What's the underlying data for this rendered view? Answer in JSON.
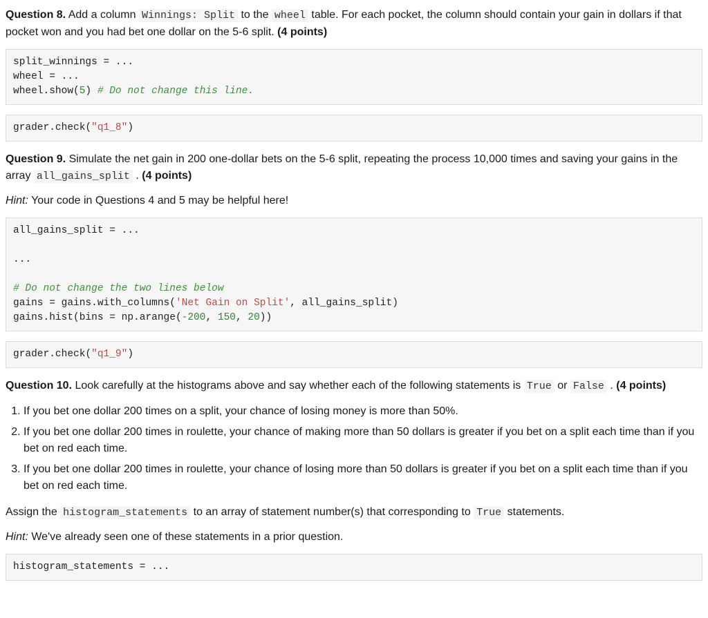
{
  "q8": {
    "label": "Question 8.",
    "text_before_code1": " Add a column ",
    "code1": "Winnings: Split",
    "text_mid1": " to the ",
    "code2": "wheel",
    "text_after": " table. For each pocket, the column should contain your gain in dollars if that pocket won and you had bet one dollar on the 5-6 split. ",
    "points": "(4 points)",
    "cell1_line1_a": "split_winnings ",
    "cell1_line1_b": "=",
    "cell1_line1_c": " ...",
    "cell1_line2_a": "wheel ",
    "cell1_line2_b": "=",
    "cell1_line2_c": " ...",
    "cell1_line3_a": "wheel.show(",
    "cell1_line3_num": "5",
    "cell1_line3_b": ") ",
    "cell1_line3_comment": "# Do not change this line.",
    "cell2_a": "grader.check(",
    "cell2_str": "\"q1_8\"",
    "cell2_b": ")"
  },
  "q9": {
    "label": "Question 9.",
    "text_a": " Simulate the net gain in 200 one-dollar bets on the 5-6 split, repeating the process 10,000 times and saving your gains in the array ",
    "code1": "all_gains_split",
    "text_b": " . ",
    "points": "(4 points)",
    "hint_label": "Hint:",
    "hint_text": " Your code in Questions 4 and 5 may be helpful here!",
    "cell1_l1_a": "all_gains_split ",
    "cell1_l1_b": "=",
    "cell1_l1_c": " ...",
    "cell1_l2": "",
    "cell1_l3": "...",
    "cell1_l4": "",
    "cell1_l5_comment": "# Do not change the two lines below",
    "cell1_l6_a": "gains ",
    "cell1_l6_b": "=",
    "cell1_l6_c": " gains.with_columns(",
    "cell1_l6_str": "'Net Gain on Split'",
    "cell1_l6_d": ", all_gains_split)",
    "cell1_l7_a": "gains.hist(bins ",
    "cell1_l7_b": "=",
    "cell1_l7_c": " np.arange(",
    "cell1_l7_neg": "-",
    "cell1_l7_n1": "200",
    "cell1_l7_d": ", ",
    "cell1_l7_n2": "150",
    "cell1_l7_e": ", ",
    "cell1_l7_n3": "20",
    "cell1_l7_f": "))",
    "cell2_a": "grader.check(",
    "cell2_str": "\"q1_9\"",
    "cell2_b": ")"
  },
  "q10": {
    "label": "Question 10.",
    "text_a": " Look carefully at the histograms above and say whether each of the following statements is ",
    "code_true": "True",
    "text_b": " or ",
    "code_false": "False",
    "text_c": " . ",
    "points": "(4 points)",
    "stmt1": "If you bet one dollar 200 times on a split, your chance of losing money is more than 50%.",
    "stmt2": "If you bet one dollar 200 times in roulette, your chance of making more than 50 dollars is greater if you bet on a split each time than if you bet on red each time.",
    "stmt3": "If you bet one dollar 200 times in roulette, your chance of losing more than 50 dollars is greater if you bet on a split each time than if you bet on red each time.",
    "assign_a": "Assign the ",
    "assign_code": "histogram_statements",
    "assign_b": " to an array of statement number(s) that corresponding to ",
    "assign_true": "True",
    "assign_c": " statements.",
    "hint_label": "Hint:",
    "hint_text": " We've already seen one of these statements in a prior question.",
    "cell_a": "histogram_statements ",
    "cell_b": "=",
    "cell_c": " ..."
  }
}
